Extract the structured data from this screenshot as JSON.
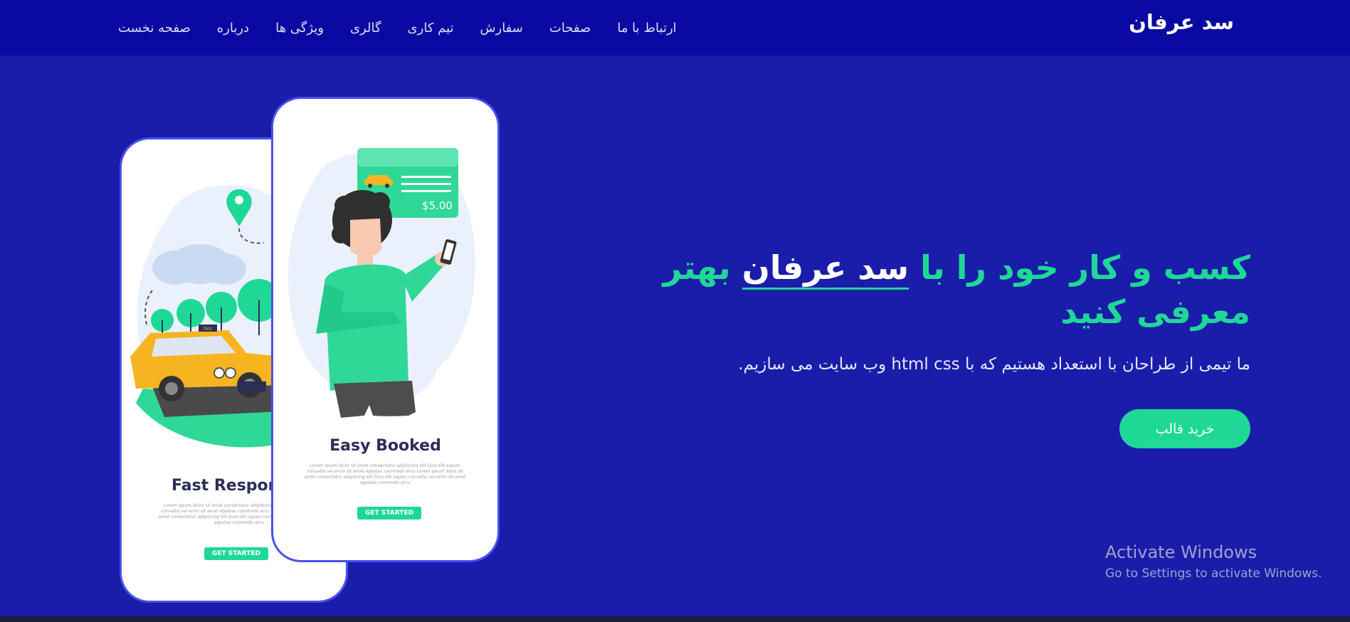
{
  "nav": {
    "brand": "سد عرفان",
    "items": [
      {
        "label": "صفحه نخست"
      },
      {
        "label": "درباره"
      },
      {
        "label": "ویژگی ها"
      },
      {
        "label": "گالری"
      },
      {
        "label": "تیم کاری"
      },
      {
        "label": "سفارش"
      },
      {
        "label": "صفحات"
      },
      {
        "label": "ارتباط با ما"
      }
    ]
  },
  "hero": {
    "headline_part1": "کسب و کار خود را با ",
    "headline_brand": "سد عرفان",
    "headline_part2": " بهتر معرفی کنید",
    "subtitle": "ما تیمی از طراحان با استعداد هستیم که با html css وب سایت می سازیم.",
    "button_label": "خرید قالب"
  },
  "phones": {
    "back": {
      "title": "Fast Respon",
      "lorem": "Lorem ipsum dolor sit amet consectetur adipiscing elit Duis elit sapien convallis vel enim sit amet egestas commodo arcu Lorem ipsum dolor sit amet consectetur adipiscing elit Duis elit sapien convallis vel enim sit amet egestas commodo arcu",
      "cta": "GET STARTED"
    },
    "front": {
      "title": "Easy Booked",
      "lorem": "Lorem ipsum dolor sit amet consectetur adipiscing elit Duis elit sapien convallis vel enim sit amet egestas commodo arcu Lorem ipsum dolor sit amet consectetur adipiscing elit Duis elit sapien convallis vel enim sit amet egestas commodo arcu",
      "cta": "GET STARTED",
      "price": "$5.00"
    }
  },
  "watermark": {
    "title": "Activate Windows",
    "subtitle": "Go to Settings to activate Windows."
  },
  "colors": {
    "background": "#1a1daa",
    "navbar": "#0a0aa2",
    "accent": "#1fd896",
    "phone_border": "#4a4ff0"
  },
  "icons": [
    "location-pin-icon",
    "taxi-illustration",
    "cloud-illustration",
    "tree-illustration",
    "person-illustration",
    "receipt-card-illustration"
  ]
}
